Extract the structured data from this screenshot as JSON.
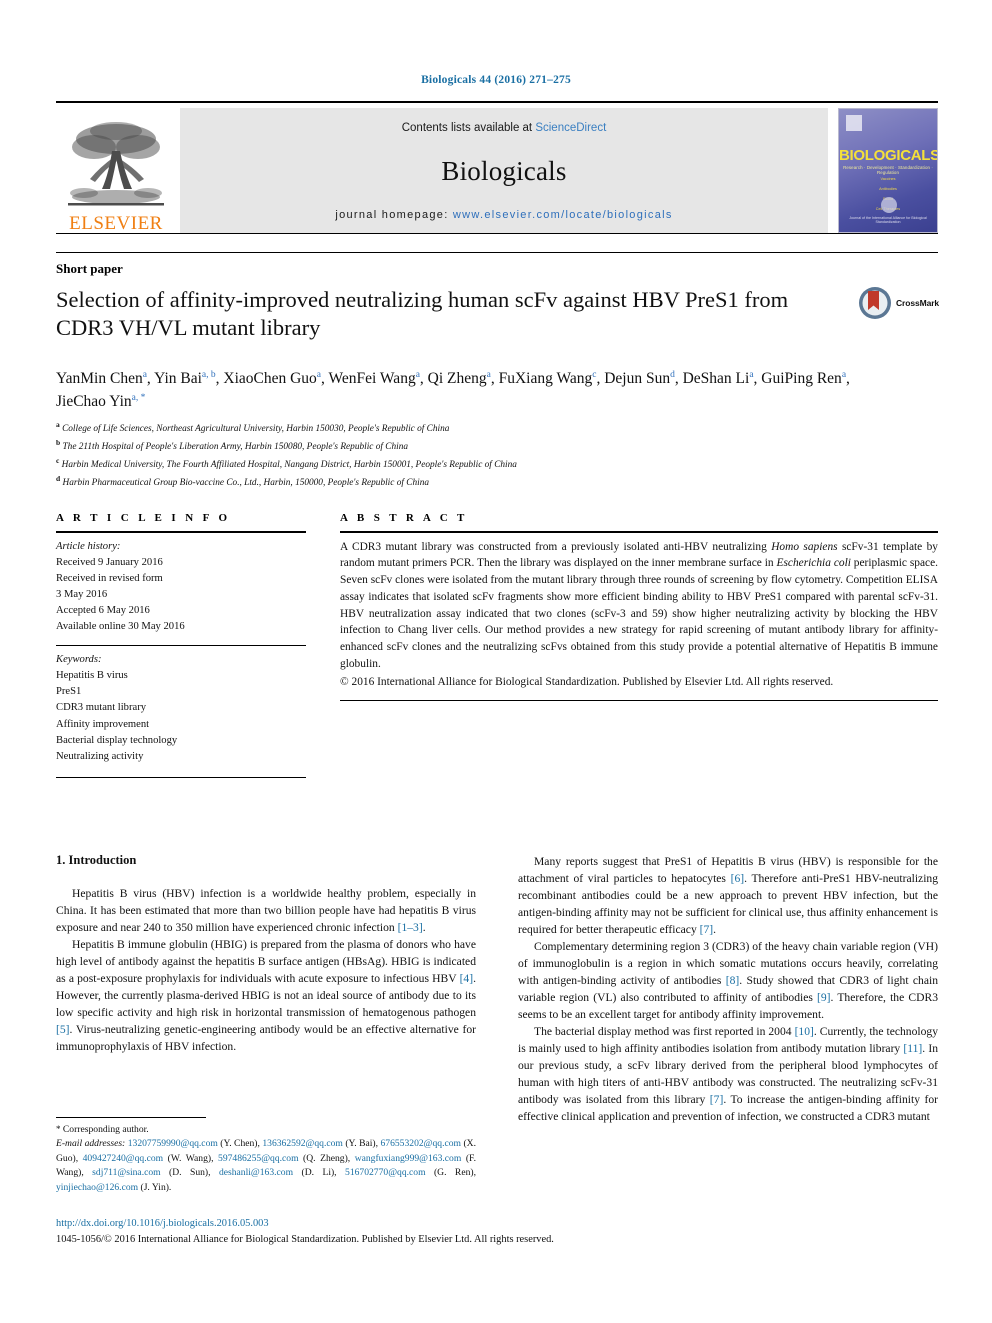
{
  "journal_ref": "Biologicals 44 (2016) 271–275",
  "masthead": {
    "publisher": "ELSEVIER",
    "contents_prefix": "Contents lists available at ",
    "contents_link": "ScienceDirect",
    "journal_title": "Biologicals",
    "homepage_prefix": "journal homepage: ",
    "homepage_link": "www.elsevier.com/locate/biologicals",
    "cover": {
      "title": "BIOLOGICALS",
      "subtitle": "Research · Development · Standardization · Regulation",
      "lines": [
        "Vaccines",
        "Antibodies",
        "Blood",
        "Cell Therapies"
      ],
      "footer": "Journal of the International Alliance for Biological Standardization"
    }
  },
  "article_type": "Short paper",
  "title": "Selection of affinity-improved neutralizing human scFv against HBV PreS1 from CDR3 VH/VL mutant library",
  "crossmark_label": "CrossMark",
  "authors": [
    {
      "name": "YanMin Chen",
      "marks": "a"
    },
    {
      "name": "Yin Bai",
      "marks": "a, b"
    },
    {
      "name": "XiaoChen Guo",
      "marks": "a"
    },
    {
      "name": "WenFei Wang",
      "marks": "a"
    },
    {
      "name": "Qi Zheng",
      "marks": "a"
    },
    {
      "name": "FuXiang Wang",
      "marks": "c"
    },
    {
      "name": "Dejun Sun",
      "marks": "d"
    },
    {
      "name": "DeShan Li",
      "marks": "a"
    },
    {
      "name": "GuiPing Ren",
      "marks": "a"
    },
    {
      "name": "JieChao Yin",
      "marks": "a, *"
    }
  ],
  "affiliations": [
    {
      "mark": "a",
      "text": "College of Life Sciences, Northeast Agricultural University, Harbin 150030, People's Republic of China"
    },
    {
      "mark": "b",
      "text": "The 211th Hospital of People's Liberation Army, Harbin 150080, People's Republic of China"
    },
    {
      "mark": "c",
      "text": "Harbin Medical University, The Fourth Affiliated Hospital, Nangang District, Harbin 150001, People's Republic of China"
    },
    {
      "mark": "d",
      "text": "Harbin Pharmaceutical Group Bio-vaccine Co., Ltd., Harbin, 150000, People's Republic of China"
    }
  ],
  "article_info": {
    "heading": "A R T I C L E  I N F O",
    "history_label": "Article history:",
    "history": [
      "Received 9 January 2016",
      "Received in revised form",
      "3 May 2016",
      "Accepted 6 May 2016",
      "Available online 30 May 2016"
    ],
    "keywords_label": "Keywords:",
    "keywords": [
      "Hepatitis B virus",
      "PreS1",
      "CDR3 mutant library",
      "Affinity improvement",
      "Bacterial display technology",
      "Neutralizing activity"
    ]
  },
  "abstract": {
    "heading": "A B S T R A C T",
    "part1": "A CDR3 mutant library was constructed from a previously isolated anti-HBV neutralizing ",
    "italic1": "Homo sapiens",
    "part2": " scFv-31 template by random mutant primers PCR. Then the library was displayed on the inner membrane surface in ",
    "italic2": "Escherichia coli",
    "part3": " periplasmic space. Seven scFv clones were isolated from the mutant library through three rounds of screening by flow cytometry. Competition ELISA assay indicates that isolated scFv fragments show more efficient binding ability to HBV PreS1 compared with parental scFv-31. HBV neutralization assay indicated that two clones (scFv-3 and 59) show higher neutralizing activity by blocking the HBV infection to Chang liver cells. Our method provides a new strategy for rapid screening of mutant antibody library for affinity-enhanced scFv clones and the neutralizing scFvs obtained from this study provide a potential alternative of Hepatitis B immune globulin.",
    "copyright": "© 2016 International Alliance for Biological Standardization. Published by Elsevier Ltd. All rights reserved."
  },
  "intro": {
    "heading": "1.  Introduction",
    "left": [
      {
        "segments": [
          {
            "t": "Hepatitis B virus (HBV) infection is a worldwide healthy problem, especially in China. It has been estimated that more than two billion people have had hepatitis B virus exposure and near 240 to 350 million have experienced chronic infection "
          },
          {
            "t": "[1–3]",
            "cite": true
          },
          {
            "t": "."
          }
        ]
      },
      {
        "segments": [
          {
            "t": "Hepatitis B immune globulin (HBIG) is prepared from the plasma of donors who have high level of antibody against the hepatitis B surface antigen (HBsAg). HBIG is indicated as a post-exposure prophylaxis for individuals with acute exposure to infectious HBV "
          },
          {
            "t": "[4]",
            "cite": true
          },
          {
            "t": ". However, the currently plasma-derived HBIG is not an ideal source of antibody due to its low specific activity and high risk in horizontal transmission of hematogenous pathogen "
          },
          {
            "t": "[5]",
            "cite": true
          },
          {
            "t": ". Virus-neutralizing genetic-engineering antibody would be an effective alternative for immunoprophylaxis of HBV infection."
          }
        ]
      }
    ],
    "right": [
      {
        "segments": [
          {
            "t": "Many reports suggest that PreS1 of Hepatitis B virus (HBV) is responsible for the attachment of viral particles to hepatocytes "
          },
          {
            "t": "[6]",
            "cite": true
          },
          {
            "t": ". Therefore anti-PreS1 HBV-neutralizing recombinant antibodies could be a new approach to prevent HBV infection, but the antigen-binding affinity may not be sufficient for clinical use, thus affinity enhancement is required for better therapeutic efficacy "
          },
          {
            "t": "[7]",
            "cite": true
          },
          {
            "t": "."
          }
        ]
      },
      {
        "segments": [
          {
            "t": "Complementary determining region 3 (CDR3) of the heavy chain variable region (VH) of immunoglobulin is a region in which somatic mutations occurs heavily, correlating with antigen-binding activity of antibodies "
          },
          {
            "t": "[8]",
            "cite": true
          },
          {
            "t": ". Study showed that CDR3 of light chain variable region (VL) also contributed to affinity of antibodies "
          },
          {
            "t": "[9]",
            "cite": true
          },
          {
            "t": ". Therefore, the CDR3 seems to be an excellent target for antibody affinity improvement."
          }
        ]
      },
      {
        "segments": [
          {
            "t": "The bacterial display method was first reported in 2004 "
          },
          {
            "t": "[10]",
            "cite": true
          },
          {
            "t": ". Currently, the technology is mainly used to high affinity antibodies isolation from antibody mutation library "
          },
          {
            "t": "[11]",
            "cite": true
          },
          {
            "t": ". In our previous study, a scFv library derived from the peripheral blood lymphocytes of human with high titers of anti-HBV antibody was constructed. The neutralizing scFv-31 antibody was isolated from this library "
          },
          {
            "t": "[7]",
            "cite": true
          },
          {
            "t": ". To increase the antigen-binding affinity for effective clinical application and prevention of infection, we constructed a CDR3 mutant"
          }
        ]
      }
    ]
  },
  "footnotes": {
    "corresponding": "Corresponding author.",
    "email_label": "E-mail addresses:",
    "emails": [
      {
        "addr": "13207759990@qq.com",
        "who": "(Y. Chen)"
      },
      {
        "addr": "136362592@qq.com",
        "who": "(Y. Bai)"
      },
      {
        "addr": "676553202@qq.com",
        "who": "(X. Guo)"
      },
      {
        "addr": "409427240@qq.com",
        "who": "(W. Wang)"
      },
      {
        "addr": "597486255@qq.com",
        "who": "(Q. Zheng)"
      },
      {
        "addr": "wangfuxiang999@163.com",
        "who": "(F. Wang)"
      },
      {
        "addr": "sdj711@sina.com",
        "who": "(D. Sun)"
      },
      {
        "addr": "deshanli@163.com",
        "who": "(D. Li)"
      },
      {
        "addr": "516702770@qq.com",
        "who": "(G. Ren)"
      },
      {
        "addr": "yinjiechao@126.com",
        "who": "(J. Yin)"
      }
    ]
  },
  "footer": {
    "doi": "http://dx.doi.org/10.1016/j.biologicals.2016.05.003",
    "issn_line": "1045-1056/© 2016 International Alliance for Biological Standardization. Published by Elsevier Ltd. All rights reserved."
  }
}
